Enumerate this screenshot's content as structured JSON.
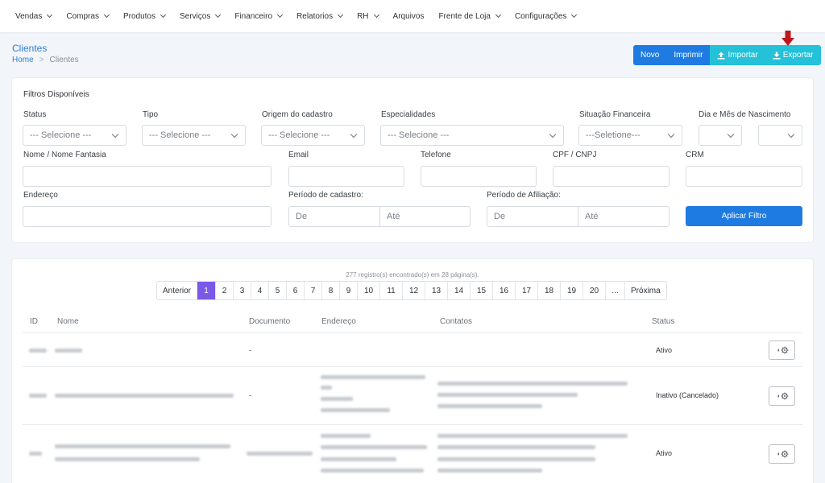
{
  "nav": {
    "items": [
      {
        "label": "Vendas",
        "caret": true
      },
      {
        "label": "Compras",
        "caret": true
      },
      {
        "label": "Produtos",
        "caret": true
      },
      {
        "label": "Serviços",
        "caret": true
      },
      {
        "label": "Financeiro",
        "caret": true
      },
      {
        "label": "Relatorios",
        "caret": true
      },
      {
        "label": "RH",
        "caret": true
      },
      {
        "label": "Arquivos",
        "caret": false
      },
      {
        "label": "Frente de Loja",
        "caret": true
      },
      {
        "label": "Configurações",
        "caret": true
      }
    ]
  },
  "header": {
    "title": "Clientes",
    "breadcrumb_home": "Home",
    "breadcrumb_sep": ">",
    "breadcrumb_current": "Clientes"
  },
  "actions": {
    "novo": "Novo",
    "imprimir": "Imprimir",
    "importar": "Importar",
    "exportar": "Exportar"
  },
  "filters": {
    "title": "Filtros Disponíveis",
    "status_label": "Status",
    "status_value": "--- Selecione ---",
    "tipo_label": "Tipo",
    "tipo_value": "--- Selecione ---",
    "origem_label": "Origem do cadastro",
    "origem_value": "--- Selecione ---",
    "especialidades_label": "Especialidades",
    "especialidades_value": "--- Selecione ---",
    "situacao_label": "Situação Financeira",
    "situacao_value": "---Seletione---",
    "nascimento_label": "Dia e Mês de Nascimento",
    "nome_label": "Nome / Nome Fantasia",
    "email_label": "Email",
    "telefone_label": "Telefone",
    "cpf_label": "CPF / CNPJ",
    "crm_label": "CRM",
    "endereco_label": "Endereço",
    "periodo_cadastro_label": "Período de cadastro:",
    "periodo_afiliacao_label": "Período de Afiliação:",
    "de_placeholder": "De",
    "ate_placeholder": "Até",
    "apply_label": "Aplicar Filtro"
  },
  "results": {
    "info": "277 registro(s) encontrado(s) em 28 página(s).",
    "pager": [
      "Anterior",
      "1",
      "2",
      "3",
      "4",
      "5",
      "6",
      "7",
      "8",
      "9",
      "10",
      "11",
      "12",
      "13",
      "14",
      "15",
      "16",
      "17",
      "18",
      "19",
      "20",
      "...",
      "Próxima"
    ],
    "active_page": "1",
    "columns": {
      "id": "ID",
      "nome": "Nome",
      "documento": "Documento",
      "endereco": "Endereço",
      "contatos": "Contatos",
      "status": "Status"
    },
    "rows": [
      {
        "documento": "-",
        "status": "Ativo"
      },
      {
        "documento": "-",
        "status": "Inativo (Cancelado)"
      },
      {
        "documento": "",
        "status": "Ativo"
      }
    ]
  },
  "colors": {
    "primary": "#1e7be2",
    "info": "#24c1d9",
    "active_page": "#7a59e6",
    "arrow": "#c0161b"
  },
  "icons": [
    "upload-icon",
    "download-icon",
    "gear-icon",
    "chevron-down-icon",
    "red-arrow-down-icon"
  ]
}
